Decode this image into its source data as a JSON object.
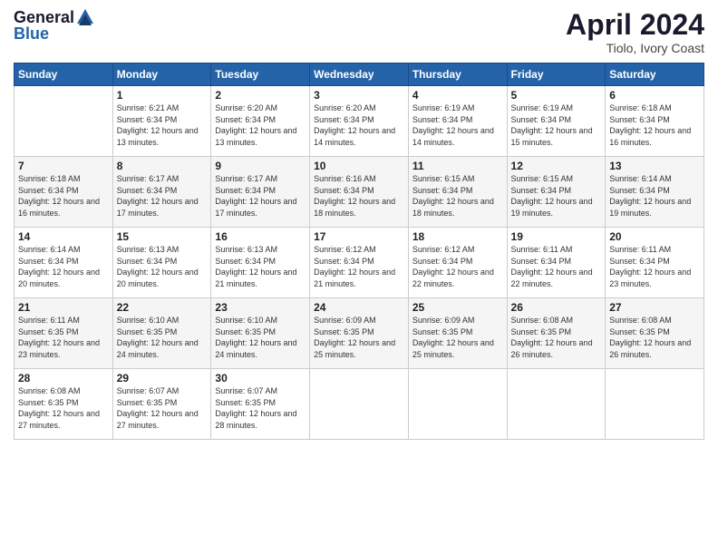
{
  "header": {
    "logo_line1": "General",
    "logo_line2": "Blue",
    "main_title": "April 2024",
    "subtitle": "Tiolo, Ivory Coast"
  },
  "days_of_week": [
    "Sunday",
    "Monday",
    "Tuesday",
    "Wednesday",
    "Thursday",
    "Friday",
    "Saturday"
  ],
  "weeks": [
    [
      {
        "num": "",
        "sunrise": "",
        "sunset": "",
        "daylight": ""
      },
      {
        "num": "1",
        "sunrise": "Sunrise: 6:21 AM",
        "sunset": "Sunset: 6:34 PM",
        "daylight": "Daylight: 12 hours and 13 minutes."
      },
      {
        "num": "2",
        "sunrise": "Sunrise: 6:20 AM",
        "sunset": "Sunset: 6:34 PM",
        "daylight": "Daylight: 12 hours and 13 minutes."
      },
      {
        "num": "3",
        "sunrise": "Sunrise: 6:20 AM",
        "sunset": "Sunset: 6:34 PM",
        "daylight": "Daylight: 12 hours and 14 minutes."
      },
      {
        "num": "4",
        "sunrise": "Sunrise: 6:19 AM",
        "sunset": "Sunset: 6:34 PM",
        "daylight": "Daylight: 12 hours and 14 minutes."
      },
      {
        "num": "5",
        "sunrise": "Sunrise: 6:19 AM",
        "sunset": "Sunset: 6:34 PM",
        "daylight": "Daylight: 12 hours and 15 minutes."
      },
      {
        "num": "6",
        "sunrise": "Sunrise: 6:18 AM",
        "sunset": "Sunset: 6:34 PM",
        "daylight": "Daylight: 12 hours and 16 minutes."
      }
    ],
    [
      {
        "num": "7",
        "sunrise": "Sunrise: 6:18 AM",
        "sunset": "Sunset: 6:34 PM",
        "daylight": "Daylight: 12 hours and 16 minutes."
      },
      {
        "num": "8",
        "sunrise": "Sunrise: 6:17 AM",
        "sunset": "Sunset: 6:34 PM",
        "daylight": "Daylight: 12 hours and 17 minutes."
      },
      {
        "num": "9",
        "sunrise": "Sunrise: 6:17 AM",
        "sunset": "Sunset: 6:34 PM",
        "daylight": "Daylight: 12 hours and 17 minutes."
      },
      {
        "num": "10",
        "sunrise": "Sunrise: 6:16 AM",
        "sunset": "Sunset: 6:34 PM",
        "daylight": "Daylight: 12 hours and 18 minutes."
      },
      {
        "num": "11",
        "sunrise": "Sunrise: 6:15 AM",
        "sunset": "Sunset: 6:34 PM",
        "daylight": "Daylight: 12 hours and 18 minutes."
      },
      {
        "num": "12",
        "sunrise": "Sunrise: 6:15 AM",
        "sunset": "Sunset: 6:34 PM",
        "daylight": "Daylight: 12 hours and 19 minutes."
      },
      {
        "num": "13",
        "sunrise": "Sunrise: 6:14 AM",
        "sunset": "Sunset: 6:34 PM",
        "daylight": "Daylight: 12 hours and 19 minutes."
      }
    ],
    [
      {
        "num": "14",
        "sunrise": "Sunrise: 6:14 AM",
        "sunset": "Sunset: 6:34 PM",
        "daylight": "Daylight: 12 hours and 20 minutes."
      },
      {
        "num": "15",
        "sunrise": "Sunrise: 6:13 AM",
        "sunset": "Sunset: 6:34 PM",
        "daylight": "Daylight: 12 hours and 20 minutes."
      },
      {
        "num": "16",
        "sunrise": "Sunrise: 6:13 AM",
        "sunset": "Sunset: 6:34 PM",
        "daylight": "Daylight: 12 hours and 21 minutes."
      },
      {
        "num": "17",
        "sunrise": "Sunrise: 6:12 AM",
        "sunset": "Sunset: 6:34 PM",
        "daylight": "Daylight: 12 hours and 21 minutes."
      },
      {
        "num": "18",
        "sunrise": "Sunrise: 6:12 AM",
        "sunset": "Sunset: 6:34 PM",
        "daylight": "Daylight: 12 hours and 22 minutes."
      },
      {
        "num": "19",
        "sunrise": "Sunrise: 6:11 AM",
        "sunset": "Sunset: 6:34 PM",
        "daylight": "Daylight: 12 hours and 22 minutes."
      },
      {
        "num": "20",
        "sunrise": "Sunrise: 6:11 AM",
        "sunset": "Sunset: 6:34 PM",
        "daylight": "Daylight: 12 hours and 23 minutes."
      }
    ],
    [
      {
        "num": "21",
        "sunrise": "Sunrise: 6:11 AM",
        "sunset": "Sunset: 6:35 PM",
        "daylight": "Daylight: 12 hours and 23 minutes."
      },
      {
        "num": "22",
        "sunrise": "Sunrise: 6:10 AM",
        "sunset": "Sunset: 6:35 PM",
        "daylight": "Daylight: 12 hours and 24 minutes."
      },
      {
        "num": "23",
        "sunrise": "Sunrise: 6:10 AM",
        "sunset": "Sunset: 6:35 PM",
        "daylight": "Daylight: 12 hours and 24 minutes."
      },
      {
        "num": "24",
        "sunrise": "Sunrise: 6:09 AM",
        "sunset": "Sunset: 6:35 PM",
        "daylight": "Daylight: 12 hours and 25 minutes."
      },
      {
        "num": "25",
        "sunrise": "Sunrise: 6:09 AM",
        "sunset": "Sunset: 6:35 PM",
        "daylight": "Daylight: 12 hours and 25 minutes."
      },
      {
        "num": "26",
        "sunrise": "Sunrise: 6:08 AM",
        "sunset": "Sunset: 6:35 PM",
        "daylight": "Daylight: 12 hours and 26 minutes."
      },
      {
        "num": "27",
        "sunrise": "Sunrise: 6:08 AM",
        "sunset": "Sunset: 6:35 PM",
        "daylight": "Daylight: 12 hours and 26 minutes."
      }
    ],
    [
      {
        "num": "28",
        "sunrise": "Sunrise: 6:08 AM",
        "sunset": "Sunset: 6:35 PM",
        "daylight": "Daylight: 12 hours and 27 minutes."
      },
      {
        "num": "29",
        "sunrise": "Sunrise: 6:07 AM",
        "sunset": "Sunset: 6:35 PM",
        "daylight": "Daylight: 12 hours and 27 minutes."
      },
      {
        "num": "30",
        "sunrise": "Sunrise: 6:07 AM",
        "sunset": "Sunset: 6:35 PM",
        "daylight": "Daylight: 12 hours and 28 minutes."
      },
      {
        "num": "",
        "sunrise": "",
        "sunset": "",
        "daylight": ""
      },
      {
        "num": "",
        "sunrise": "",
        "sunset": "",
        "daylight": ""
      },
      {
        "num": "",
        "sunrise": "",
        "sunset": "",
        "daylight": ""
      },
      {
        "num": "",
        "sunrise": "",
        "sunset": "",
        "daylight": ""
      }
    ]
  ]
}
